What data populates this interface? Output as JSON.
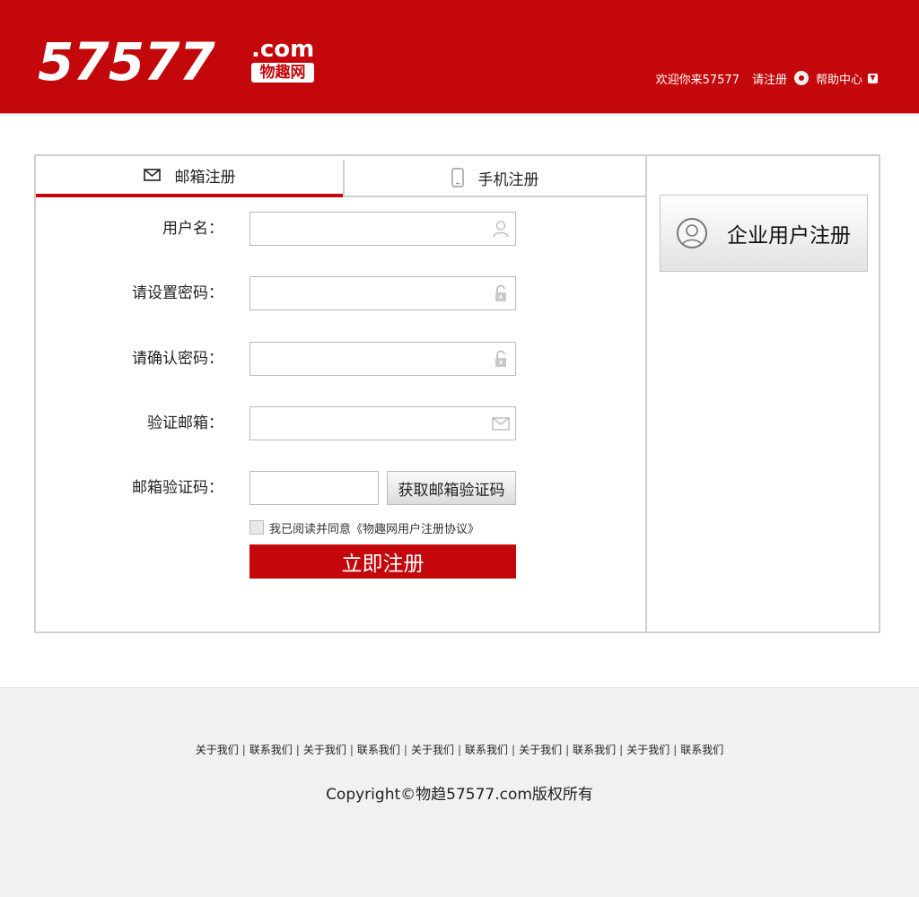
{
  "header": {
    "logo_number": "57577",
    "logo_com": ".com",
    "logo_cn": "物趣网",
    "welcome": "欢迎你来57577",
    "register_link": "请注册",
    "help_center": "帮助中心"
  },
  "tabs": [
    {
      "label": "邮箱注册",
      "icon": "mail-icon",
      "active": true
    },
    {
      "label": "手机注册",
      "icon": "phone-icon",
      "active": false
    }
  ],
  "form": {
    "username_label": "用户名：",
    "password_label": "请设置密码：",
    "confirm_label": "请确认密码：",
    "email_label": "验证邮箱：",
    "code_label": "邮箱验证码：",
    "username_value": "",
    "password_value": "",
    "confirm_value": "",
    "email_value": "",
    "code_value": "",
    "get_code_button": "获取邮箱验证码",
    "agreement": "我已阅读并同意《物趣网用户注册协议》",
    "submit_button": "立即注册"
  },
  "enterprise": {
    "label": "企业用户注册",
    "icon": "user-circle-icon"
  },
  "footer": {
    "links": [
      "关于我们",
      "联系我们",
      "关于我们",
      "联系我们",
      "关于我们",
      "联系我们",
      "关于我们",
      "联系我们",
      "关于我们",
      "联系我们"
    ],
    "copyright": "Copyright©物趋57577.com版权所有"
  },
  "colors": {
    "brand_red": "#c4070b",
    "border_gray": "#cfcfcf",
    "footer_bg": "#f1f1f1"
  }
}
